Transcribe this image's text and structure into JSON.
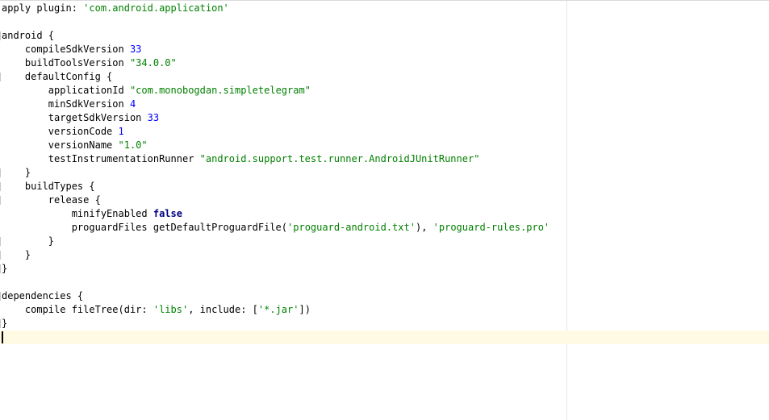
{
  "editor": {
    "language": "groovy",
    "colors": {
      "background": "#ffffff",
      "current_line": "#fffae3",
      "string": "#008000",
      "number": "#0000ff",
      "keyword": "#000080",
      "text": "#000000"
    },
    "current_line_index": 24,
    "lines": [
      [
        [
          "pl",
          "apply plugin: "
        ],
        [
          "str",
          "'com.android.application'"
        ]
      ],
      [],
      [
        [
          "pl",
          "android {"
        ]
      ],
      [
        [
          "pl",
          "    compileSdkVersion "
        ],
        [
          "num",
          "33"
        ]
      ],
      [
        [
          "pl",
          "    buildToolsVersion "
        ],
        [
          "str",
          "\"34.0.0\""
        ]
      ],
      [
        [
          "pl",
          "    defaultConfig {"
        ]
      ],
      [
        [
          "pl",
          "        applicationId "
        ],
        [
          "str",
          "\"com.monobogdan.simpletelegram\""
        ]
      ],
      [
        [
          "pl",
          "        minSdkVersion "
        ],
        [
          "num",
          "4"
        ]
      ],
      [
        [
          "pl",
          "        targetSdkVersion "
        ],
        [
          "num",
          "33"
        ]
      ],
      [
        [
          "pl",
          "        versionCode "
        ],
        [
          "num",
          "1"
        ]
      ],
      [
        [
          "pl",
          "        versionName "
        ],
        [
          "str",
          "\"1.0\""
        ]
      ],
      [
        [
          "pl",
          "        testInstrumentationRunner "
        ],
        [
          "str",
          "\"android.support.test.runner.AndroidJUnitRunner\""
        ]
      ],
      [
        [
          "pl",
          "    }"
        ]
      ],
      [
        [
          "pl",
          "    buildTypes {"
        ]
      ],
      [
        [
          "pl",
          "        release {"
        ]
      ],
      [
        [
          "pl",
          "            minifyEnabled "
        ],
        [
          "kw",
          "false"
        ]
      ],
      [
        [
          "pl",
          "            proguardFiles getDefaultProguardFile("
        ],
        [
          "str",
          "'proguard-android.txt'"
        ],
        [
          "pl",
          "), "
        ],
        [
          "str",
          "'proguard-rules.pro'"
        ]
      ],
      [
        [
          "pl",
          "        }"
        ]
      ],
      [
        [
          "pl",
          "    }"
        ]
      ],
      [
        [
          "pl",
          "}"
        ]
      ],
      [],
      [
        [
          "pl",
          "dependencies {"
        ]
      ],
      [
        [
          "pl",
          "    compile fileTree(dir: "
        ],
        [
          "str",
          "'libs'"
        ],
        [
          "pl",
          ", include: ["
        ],
        [
          "str",
          "'*.jar'"
        ],
        [
          "pl",
          "])"
        ]
      ],
      [
        [
          "pl",
          "}"
        ]
      ],
      []
    ],
    "fold_marker_lines": [
      2,
      5,
      12,
      13,
      14,
      17,
      18,
      19,
      21,
      23
    ]
  }
}
